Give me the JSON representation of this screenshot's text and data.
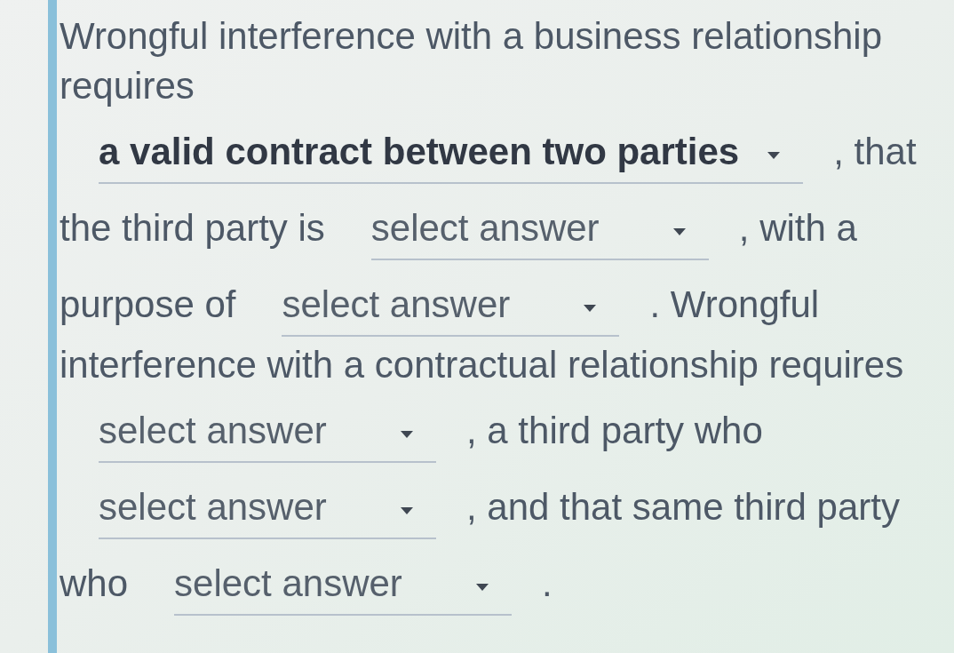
{
  "question": {
    "lines": [
      {
        "segments": [
          {
            "kind": "text",
            "text": "Wrongful interference with a business relationship"
          }
        ]
      },
      {
        "segments": [
          {
            "kind": "text",
            "text": "requires"
          }
        ]
      },
      {
        "segments": [
          {
            "kind": "dropdown",
            "value": "a valid contract between two parties"
          },
          {
            "kind": "text",
            "text": ", that"
          }
        ]
      },
      {
        "segments": [
          {
            "kind": "text",
            "text": "the third party is"
          },
          {
            "kind": "dropdown",
            "placeholder": "select answer"
          },
          {
            "kind": "text",
            "text": ", with a"
          }
        ]
      },
      {
        "segments": [
          {
            "kind": "text",
            "text": "purpose of"
          },
          {
            "kind": "dropdown",
            "placeholder": "select answer"
          },
          {
            "kind": "text",
            "text": ". Wrongful"
          }
        ]
      },
      {
        "segments": [
          {
            "kind": "text",
            "text": "interference with a contractual relationship requires"
          }
        ]
      },
      {
        "segments": [
          {
            "kind": "dropdown",
            "placeholder": "select answer"
          },
          {
            "kind": "text",
            "text": ", a third party who"
          }
        ]
      },
      {
        "segments": [
          {
            "kind": "dropdown",
            "placeholder": "select answer"
          },
          {
            "kind": "text",
            "text": ", and that same third party"
          }
        ]
      },
      {
        "segments": [
          {
            "kind": "text",
            "text": "who"
          },
          {
            "kind": "dropdown",
            "placeholder": "select answer"
          },
          {
            "kind": "text",
            "text": "."
          }
        ]
      }
    ]
  }
}
